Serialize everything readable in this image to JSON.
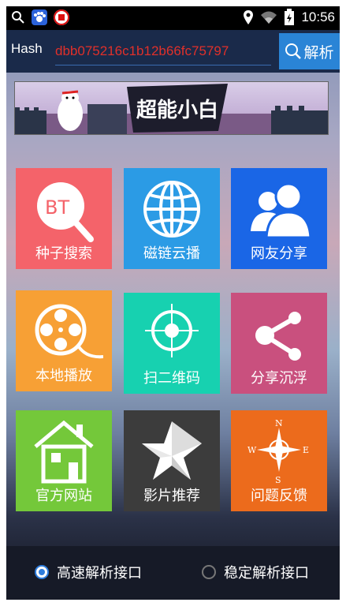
{
  "status_bar": {
    "time": "10:56",
    "icons": [
      "search-icon",
      "baidu-paw-icon",
      "app-red-icon",
      "location-icon",
      "wifi-icon",
      "battery-charging-icon"
    ]
  },
  "hash_bar": {
    "label": "Hash",
    "value": "dbb075216c1b12b66fc75797",
    "button_label": "解析"
  },
  "banner": {
    "title": "超能小白"
  },
  "tiles": [
    {
      "label": "种子搜索",
      "color": "#f4636a",
      "icon": "bt-search-icon"
    },
    {
      "label": "磁链云播",
      "color": "#2b9be5",
      "icon": "globe-icon"
    },
    {
      "label": "网友分享",
      "color": "#1a66e6",
      "icon": "users-icon"
    },
    {
      "label": "本地播放",
      "color": "#f7a035",
      "icon": "film-reel-icon"
    },
    {
      "label": "扫二维码",
      "color": "#17d1b0",
      "icon": "crosshair-icon"
    },
    {
      "label": "分享沉浮",
      "color": "#c9507e",
      "icon": "share-icon"
    },
    {
      "label": "官方网站",
      "color": "#74c83a",
      "icon": "house-icon"
    },
    {
      "label": "影片推荐",
      "color": "#3c3c3c",
      "icon": "star-icon"
    },
    {
      "label": "问题反馈",
      "color": "#ec6b1c",
      "icon": "compass-icon"
    }
  ],
  "bt_text": "BT",
  "compass": {
    "n": "N",
    "s": "S",
    "e": "E",
    "w": "W"
  },
  "options": [
    {
      "label": "高速解析接口",
      "selected": true
    },
    {
      "label": "稳定解析接口",
      "selected": false
    }
  ]
}
